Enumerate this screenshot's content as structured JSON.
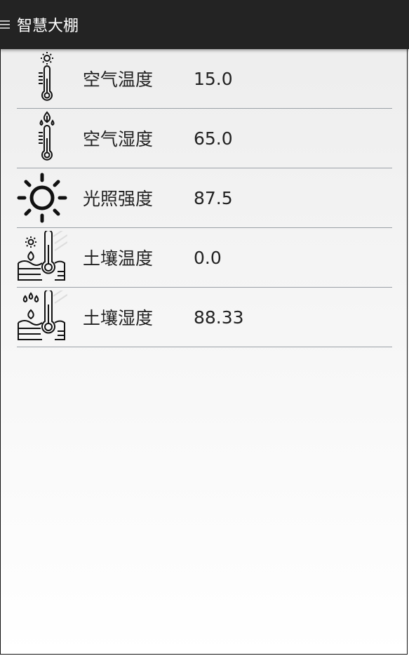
{
  "app": {
    "title": "智慧大棚"
  },
  "sensors": [
    {
      "icon": "air-temperature-icon",
      "label": "空气温度",
      "value": "15.0"
    },
    {
      "icon": "air-humidity-icon",
      "label": "空气湿度",
      "value": "65.0"
    },
    {
      "icon": "sun-icon",
      "label": "光照强度",
      "value": "87.5"
    },
    {
      "icon": "soil-temperature-icon",
      "label": "土壤温度",
      "value": "0.0"
    },
    {
      "icon": "soil-humidity-icon",
      "label": "土壤湿度",
      "value": "88.33"
    }
  ]
}
